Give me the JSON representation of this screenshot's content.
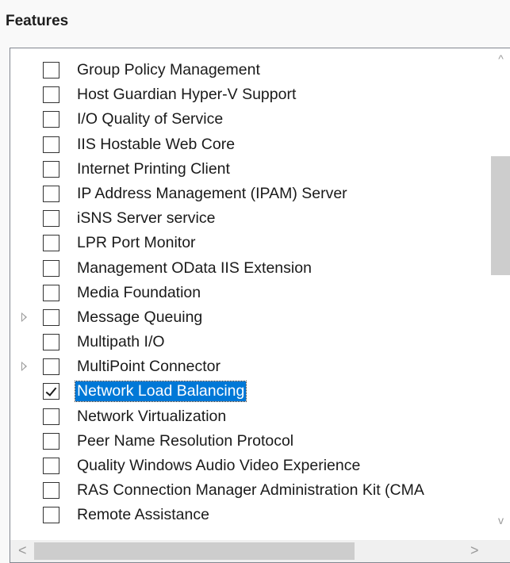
{
  "section": {
    "title": "Features"
  },
  "features": [
    {
      "label": "Group Policy Management",
      "checked": false,
      "expandable": false,
      "selected": false
    },
    {
      "label": "Host Guardian Hyper-V Support",
      "checked": false,
      "expandable": false,
      "selected": false
    },
    {
      "label": "I/O Quality of Service",
      "checked": false,
      "expandable": false,
      "selected": false
    },
    {
      "label": "IIS Hostable Web Core",
      "checked": false,
      "expandable": false,
      "selected": false
    },
    {
      "label": "Internet Printing Client",
      "checked": false,
      "expandable": false,
      "selected": false
    },
    {
      "label": "IP Address Management (IPAM) Server",
      "checked": false,
      "expandable": false,
      "selected": false
    },
    {
      "label": "iSNS Server service",
      "checked": false,
      "expandable": false,
      "selected": false
    },
    {
      "label": "LPR Port Monitor",
      "checked": false,
      "expandable": false,
      "selected": false
    },
    {
      "label": "Management OData IIS Extension",
      "checked": false,
      "expandable": false,
      "selected": false
    },
    {
      "label": "Media Foundation",
      "checked": false,
      "expandable": false,
      "selected": false
    },
    {
      "label": "Message Queuing",
      "checked": false,
      "expandable": true,
      "selected": false
    },
    {
      "label": "Multipath I/O",
      "checked": false,
      "expandable": false,
      "selected": false
    },
    {
      "label": "MultiPoint Connector",
      "checked": false,
      "expandable": true,
      "selected": false
    },
    {
      "label": "Network Load Balancing",
      "checked": true,
      "expandable": false,
      "selected": true
    },
    {
      "label": "Network Virtualization",
      "checked": false,
      "expandable": false,
      "selected": false
    },
    {
      "label": "Peer Name Resolution Protocol",
      "checked": false,
      "expandable": false,
      "selected": false
    },
    {
      "label": "Quality Windows Audio Video Experience",
      "checked": false,
      "expandable": false,
      "selected": false
    },
    {
      "label": "RAS Connection Manager Administration Kit (CMA",
      "checked": false,
      "expandable": false,
      "selected": false
    },
    {
      "label": "Remote Assistance",
      "checked": false,
      "expandable": false,
      "selected": false
    }
  ],
  "scrollbars": {
    "up_icon": "chevron-up-icon",
    "down_icon": "chevron-down-icon",
    "left_icon": "chevron-left-icon",
    "right_icon": "chevron-right-icon",
    "up_glyph": "^",
    "down_glyph": "v",
    "left_glyph": "<",
    "right_glyph": ">"
  },
  "colors": {
    "selection": "#0078d7",
    "thumb": "#cdcdcd"
  }
}
